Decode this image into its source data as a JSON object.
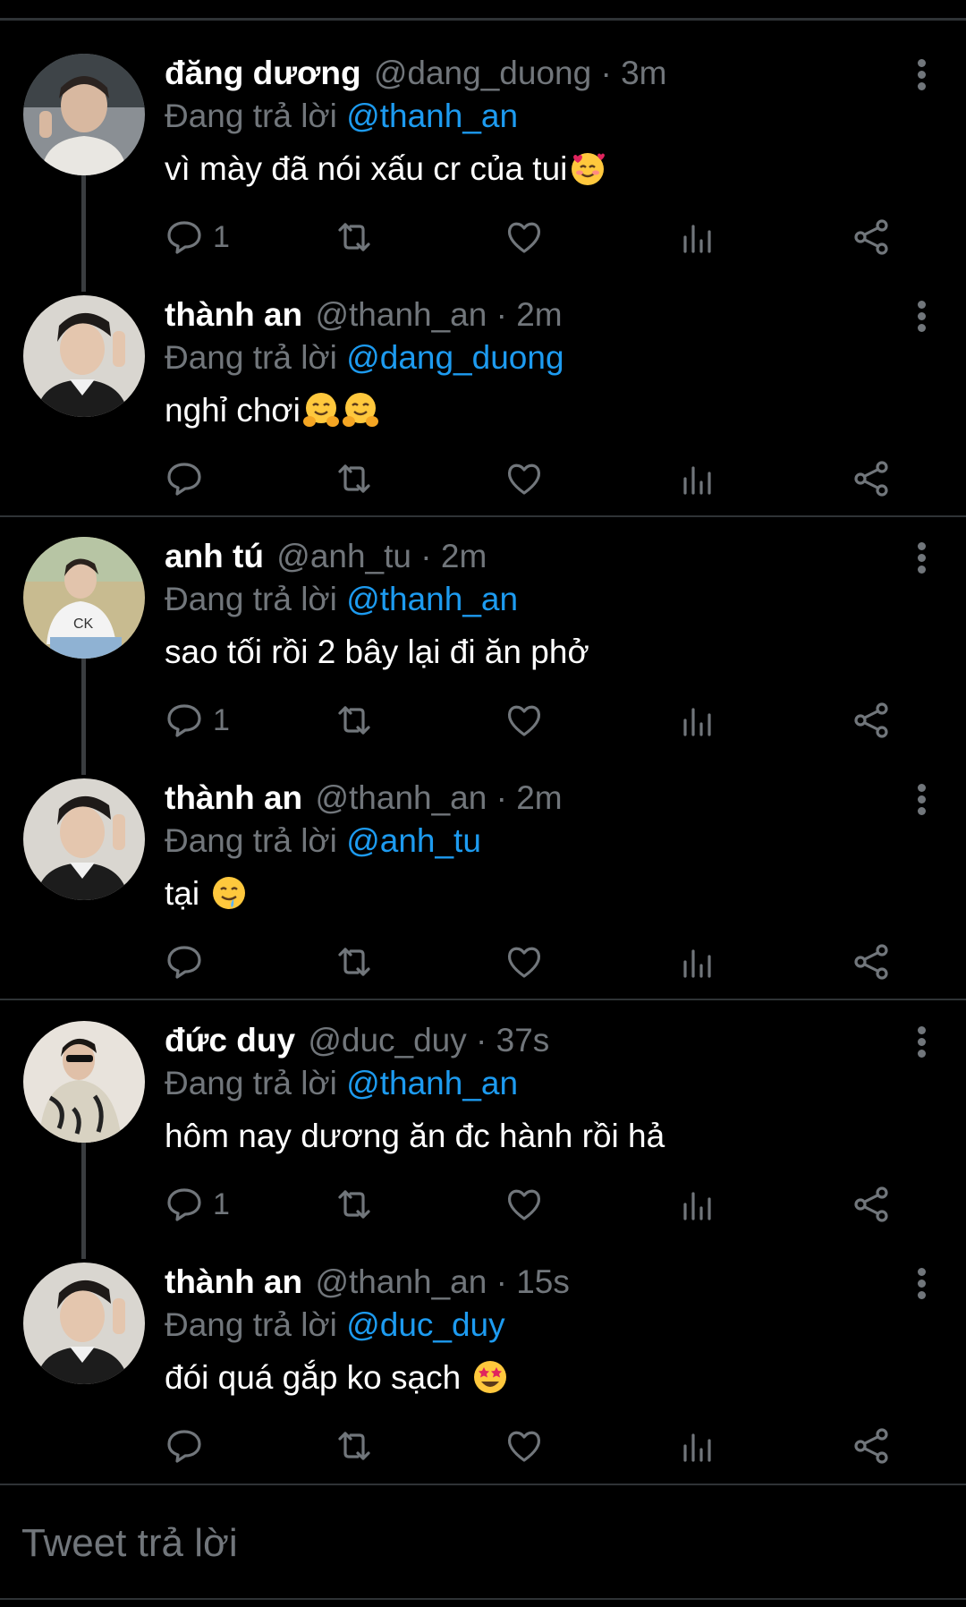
{
  "composer": {
    "placeholder": "Tweet trả lời"
  },
  "reply_prefix": "Đang trả lời",
  "tweets": [
    {
      "name": "đăng dương",
      "handle": "@dang_duong",
      "time": "3m",
      "reply_to": "@thanh_an",
      "text": "vì mày đã nói xấu cr của tui",
      "emoji": [
        "smiling-face-with-hearts"
      ],
      "replies": "1"
    },
    {
      "name": "thành an",
      "handle": "@thanh_an",
      "time": "2m",
      "reply_to": "@dang_duong",
      "text": "nghỉ chơi",
      "emoji": [
        "hugging-face",
        "hugging-face"
      ],
      "replies": ""
    },
    {
      "name": "anh tú",
      "handle": "@anh_tu",
      "time": "2m",
      "reply_to": "@thanh_an",
      "text": "sao tối rồi 2 bây lại đi ăn phở",
      "emoji": [],
      "replies": "1"
    },
    {
      "name": "thành an",
      "handle": "@thanh_an",
      "time": "2m",
      "reply_to": "@anh_tu",
      "text": "tại ",
      "emoji": [
        "drooling-face"
      ],
      "replies": ""
    },
    {
      "name": "đức duy",
      "handle": "@duc_duy",
      "time": "37s",
      "reply_to": "@thanh_an",
      "text": "hôm nay dương ăn đc hành rồi hả",
      "emoji": [],
      "replies": "1"
    },
    {
      "name": "thành an",
      "handle": "@thanh_an",
      "time": "15s",
      "reply_to": "@duc_duy",
      "text": "đói quá gắp ko sạch ",
      "emoji": [
        "star-struck-face"
      ],
      "replies": ""
    }
  ],
  "colors": {
    "background": "#000000",
    "muted": "#71767b",
    "link": "#1d9bf0",
    "divider": "#2f3336"
  }
}
